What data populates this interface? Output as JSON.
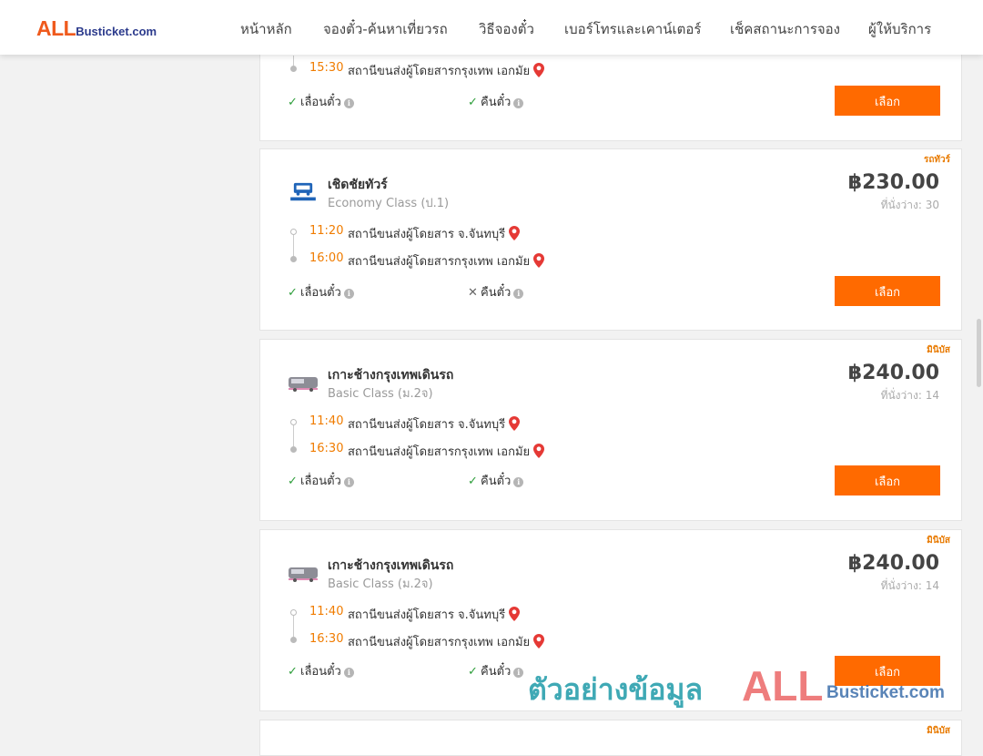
{
  "header": {
    "logo": {
      "all": "ALL",
      "rest": "Busticket.com"
    },
    "nav": [
      "หน้าหลัก",
      "จองตั๋ว-ค้นหาเที่ยวรถ",
      "วิธีจองตั๋ว",
      "เบอร์โทรและเคาน์เตอร์",
      "เช็คสถานะการจอง",
      "ผู้ให้บริการ"
    ]
  },
  "colors": {
    "accent": "#ff6a00",
    "time": "#f07c00",
    "check": "#2e9e3b",
    "pin": "#e53935"
  },
  "cards": [
    {
      "departure_time": "",
      "departure_station": "",
      "arrival_time": "15:30",
      "arrival_station": "สถานีขนส่งผู้โดยสารกรุงเทพ เอกมัย",
      "features": [
        {
          "label": "เลื่อนตั๋ว",
          "available": true,
          "mark": "✓"
        },
        {
          "label": "คืนตั๋ว",
          "available": true,
          "mark": "✓"
        }
      ],
      "button": "เลือก"
    },
    {
      "badge": "รถทัวร์",
      "operator": "เชิดชัยทัวร์",
      "bus_class": "Economy Class (ป.1)",
      "price": "฿230.00",
      "seats": "ที่นั่งว่าง: 30",
      "departure_time": "11:20",
      "departure_station": "สถานีขนส่งผู้โดยสาร จ.จันทบุรี",
      "arrival_time": "16:00",
      "arrival_station": "สถานีขนส่งผู้โดยสารกรุงเทพ เอกมัย",
      "features": [
        {
          "label": "เลื่อนตั๋ว",
          "available": true,
          "mark": "✓"
        },
        {
          "label": "คืนตั๋ว",
          "available": false,
          "mark": "✕"
        }
      ],
      "button": "เลือก"
    },
    {
      "badge": "มินิบัส",
      "operator": "เกาะช้างกรุงเทพเดินรถ",
      "bus_class": "Basic Class (ม.2จ)",
      "price": "฿240.00",
      "seats": "ที่นั่งว่าง: 14",
      "departure_time": "11:40",
      "departure_station": "สถานีขนส่งผู้โดยสาร จ.จันทบุรี",
      "arrival_time": "16:30",
      "arrival_station": "สถานีขนส่งผู้โดยสารกรุงเทพ เอกมัย",
      "features": [
        {
          "label": "เลื่อนตั๋ว",
          "available": true,
          "mark": "✓"
        },
        {
          "label": "คืนตั๋ว",
          "available": true,
          "mark": "✓"
        }
      ],
      "button": "เลือก"
    },
    {
      "badge": "มินิบัส",
      "operator": "เกาะช้างกรุงเทพเดินรถ",
      "bus_class": "Basic Class (ม.2จ)",
      "price": "฿240.00",
      "seats": "ที่นั่งว่าง: 14",
      "departure_time": "11:40",
      "departure_station": "สถานีขนส่งผู้โดยสาร จ.จันทบุรี",
      "arrival_time": "16:30",
      "arrival_station": "สถานีขนส่งผู้โดยสารกรุงเทพ เอกมัย",
      "features": [
        {
          "label": "เลื่อนตั๋ว",
          "available": true,
          "mark": "✓"
        },
        {
          "label": "คืนตั๋ว",
          "available": true,
          "mark": "✓"
        }
      ],
      "button": "เลือก"
    },
    {
      "badge": "มินิบัส"
    }
  ],
  "watermark": {
    "text": "ตัวอย่างข้อมูล",
    "all": "ALL",
    "rest": "Busticket.com"
  }
}
